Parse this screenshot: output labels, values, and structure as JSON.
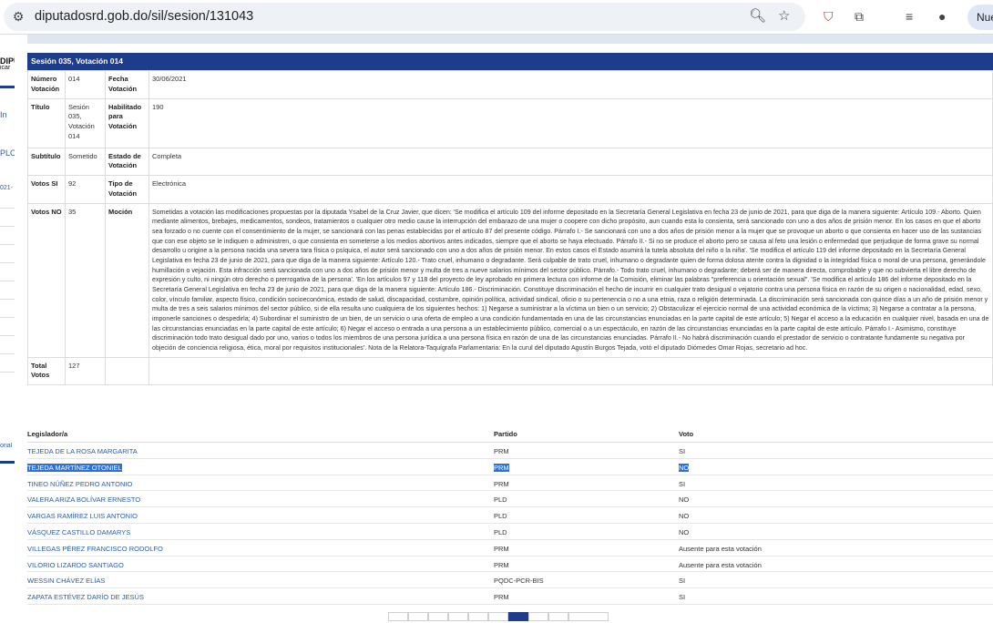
{
  "browser": {
    "url": "diputadosrd.gob.do/sil/sesion/131043",
    "profile_label": "Nue"
  },
  "background": {
    "texts": [
      "DIPU",
      "icar",
      "In",
      "PLO",
      "021-",
      "orial"
    ]
  },
  "modal": {
    "header": "Sesión 035, Votación 014",
    "details": {
      "numero_label": "Número Votación",
      "numero_value": "014",
      "fecha_label": "Fecha Votación",
      "fecha_value": "30/06/2021",
      "titulo_label": "Título",
      "titulo_value": "Sesión 035, Votación 014",
      "habilitado_label": "Habilitado para Votación",
      "habilitado_value": "190",
      "subtitulo_label": "Subtítulo",
      "subtitulo_value": "Sometido",
      "estado_label": "Estado de Votación",
      "estado_value": "Completa",
      "si_label": "Votos SI",
      "si_value": "92",
      "tipo_label": "Tipo de Votación",
      "tipo_value": "Electrónica",
      "no_label": "Votos NO",
      "no_value": "35",
      "mocion_label": "Moción",
      "mocion_value": "Sometidas a votación las modificaciones propuestas por la diputada Ysabel de la Cruz Javier, que dicen: 'Se modifica el artículo 109 del informe depositado en la Secretaría General Legislativa en fecha 23 de junio de 2021, para que diga de la manera siguiente: Artículo 109.- Aborto. Quien mediante alimentos, brebajes, medicamentos, sondeos, tratamientos o cualquier otro medio cause la interrupción del embarazo de una mujer o coopere con dicho propósito, aun cuando esta lo consienta, será sancionado con uno a dos años de prisión menor. En los casos en que el aborto sea forzado o no cuente con el consentimiento de la mujer, se sancionará con las penas establecidas por el artículo 87 del presente código. Párrafo I.- Se sancionará con uno a dos años de prisión menor a la mujer que se provoque un aborto o que consienta en hacer uso de las sustancias que con ese objeto se le indiquen o administren, o que consienta en someterse a los medios abortivos antes indicados, siempre que el aborto se haya efectuado. Párrafo II.- Si no se produce el aborto pero se causa al feto una lesión o enfermedad que perjudique de forma grave su normal desarrollo u origine a la persona nacida una severa tara física o psíquica, el autor será sancionado con uno a dos años de prisión menor. En estos casos el Estado asumirá la tutela absoluta del niño o la niña'. 'Se modifica el artículo 119 del informe depositado en la Secretaría General Legislativa en fecha 23 de junio de 2021, para que diga de la manera siguiente: Artículo 120.- Trato cruel, inhumano o degradante. Será culpable de trato cruel, inhumano o degradante quien de forma dolosa atente contra la dignidad o la integridad física o moral de una persona, generándole humillación o vejación. Esta infracción será sancionada con uno a dos años de prisión menor y multa de tres a nueve salarios mínimos del sector público. Párrafo.- Todo trato cruel, inhumano o degradante; deberá ser de manera directa, comprobable y que no subvierta el libre derecho de expresión y culto, ni ningún otro derecho o prerrogativa de la persona'. 'En los artículos 97 y 118 del proyecto de ley aprobado en primera lectura con informe de la Comisión, eliminar las palabras \"preferencia u orientación sexual\". 'Se modifica el artículo 186 del informe depositado en la Secretaría General Legislativa en fecha 23 de junio de 2021, para que diga de la manera siguiente: Artículo 186.- Discriminación. Constituye discriminación el hecho de incurrir en cualquier trato desigual o vejatorio contra una persona física en razón de su origen o nacionalidad, edad, sexo, color, vínculo familiar, aspecto físico, condición socioeconómica, estado de salud, discapacidad, costumbre, opinión política, actividad sindical, oficio o su pertenencia o no a una etnia, raza o religión determinada. La discriminación será sancionada con quince días a un año de prisión menor y multa de tres a seis salarios mínimos del sector público, si de ella resulta uno cualquiera de los siguientes hechos: 1) Negarse a suministrar a la víctima un bien o un servicio; 2) Obstaculizar el ejercicio normal de una actividad económica de la víctima; 3) Negarse a contratar a la persona, imponerle sanciones o despedirla; 4) Subordinar el suministro de un bien, de un servicio o una oferta de empleo a una condición fundamentada en una de las circunstancias enunciadas en la parte capital de este artículo; 5) Negar el acceso a la educación en cualquier nivel, basada en una de las circunstancias enunciadas en la parte capital de este artículo; 6) Negar el acceso o entrada a una persona a un establecimiento público, comercial o a un espectáculo, en razón de las circunstancias enunciadas en la parte capital de este artículo. Párrafo I.- Asimismo, constituye discriminación todo trato desigual dado por uno, varios o todos los miembros de una persona jurídica a una persona física en razón de una de las circunstancias enunciadas. Párrafo II.- No habrá discriminación cuando el prestador de servicio o contratante fundamente su negativa por objeción de conciencia religiosa, ética, moral por requisitos institucionales'. Nota de la Relatora-Taquígrafa Parlamentaria: En la curul del diputado Agustín Burgos Tejada, votó el diputado Diómedes Omar Rojas, secretario ad hoc.",
      "total_label": "Total Votos",
      "total_value": "127"
    },
    "votes_table": {
      "headers": [
        "Legislador/a",
        "Partido",
        "Voto"
      ],
      "rows": [
        [
          "TEJEDA DE LA ROSA MARGARITA",
          "PRM",
          "SI"
        ],
        [
          "TEJEDA MARTÍNEZ OTONIEL",
          "PRM",
          "NO"
        ],
        [
          "TINEO NÚÑEZ PEDRO ANTONIO",
          "PRM",
          "SI"
        ],
        [
          "VALERA ARIZA BOLÍVAR ERNESTO",
          "PLD",
          "NO"
        ],
        [
          "VARGAS RAMÍREZ LUIS ANTONIO",
          "PLD",
          "NO"
        ],
        [
          "VÁSQUEZ CASTILLO DAMARYS",
          "PLD",
          "NO"
        ],
        [
          "VILLEGAS PÉREZ FRANCISCO RODOLFO",
          "PRM",
          "Ausente para esta votación"
        ],
        [
          "VILORIO LIZARDO SANTIAGO",
          "PRM",
          "Ausente para esta votación"
        ],
        [
          "WESSIN CHÁVEZ ELÍAS",
          "PQDC-PCR-BIS",
          "SI"
        ],
        [
          "ZAPATA ESTÉVEZ DARÍO DE JESÚS",
          "PRM",
          "SI"
        ]
      ]
    }
  }
}
